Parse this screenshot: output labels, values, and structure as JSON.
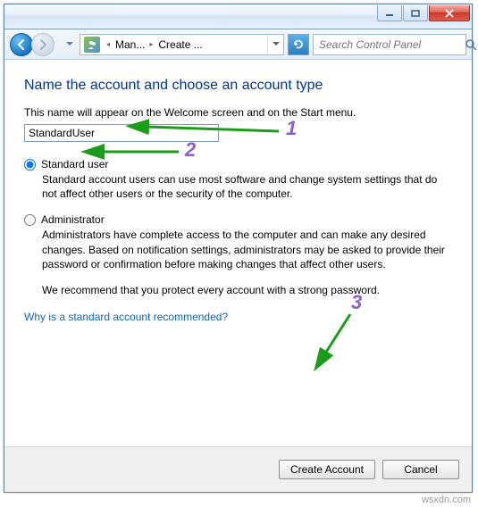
{
  "titlebar": {},
  "nav": {
    "back_enabled": true,
    "forward_enabled": false,
    "breadcrumb1": "Man...",
    "breadcrumb2": "Create ..."
  },
  "search": {
    "placeholder": "Search Control Panel"
  },
  "page": {
    "heading": "Name the account and choose an account type",
    "intro": "This name will appear on the Welcome screen and on the Start menu.",
    "account_name_value": "StandardUser"
  },
  "options": {
    "standard": {
      "label": "Standard user",
      "desc": "Standard account users can use most software and change system settings that do not affect other users or the security of the computer.",
      "checked": true
    },
    "admin": {
      "label": "Administrator",
      "desc": "Administrators have complete access to the computer and can make any desired changes. Based on notification settings, administrators may be asked to provide their password or confirmation before making changes that affect other users.",
      "checked": false
    },
    "recommend": "We recommend that you protect every account with a strong password."
  },
  "link": {
    "why": "Why is a standard account recommended?"
  },
  "buttons": {
    "create": "Create Account",
    "cancel": "Cancel"
  },
  "annotations": {
    "n1": "1",
    "n2": "2",
    "n3": "3"
  },
  "watermark": "wsxdn.com"
}
